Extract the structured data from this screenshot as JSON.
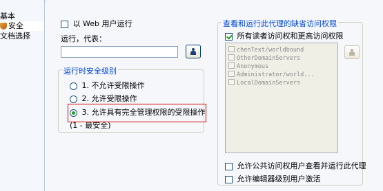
{
  "sidebar": {
    "items": [
      {
        "label": "基本"
      },
      {
        "label": "安全"
      },
      {
        "label": "文档选择"
      }
    ]
  },
  "runas": {
    "checkbox_label": "以 Web 用户运行",
    "field_label": "运行，代表：",
    "field_value": ""
  },
  "security_level": {
    "legend": "运行时安全级别",
    "options": [
      {
        "label": "1. 不允许受限操作",
        "selected": false
      },
      {
        "label": "2. 允许受限操作",
        "selected": false
      },
      {
        "label": "3. 允许具有完全管理权限的受限操作",
        "selected": true
      }
    ],
    "note": "(1 - 最安全)"
  },
  "access": {
    "legend": "查看和运行此代理的缺省访问权限",
    "all_readers_label": "所有读者访问权和更高访问权限",
    "list_items": [
      "chenText/worldbound",
      "OtherDomainServers",
      "Anonymous",
      "Administrator/world...",
      "LocalDomainServers"
    ],
    "public_access_label": "允许公共访问权用户查看并运行此代理",
    "editor_activate_label": "允许编辑器级别用户激活"
  }
}
